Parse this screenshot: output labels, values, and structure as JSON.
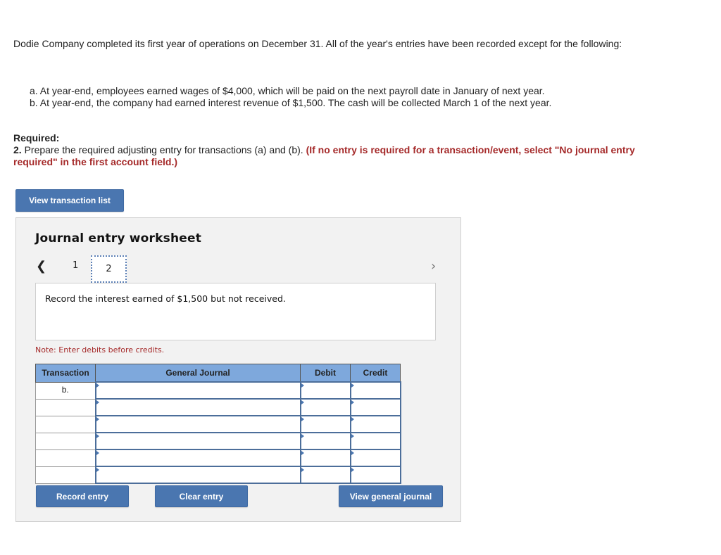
{
  "problem": {
    "intro": "Dodie Company completed its first year of operations on December 31. All of the year's entries have been recorded except for the following:",
    "items": [
      "a. At year-end, employees earned wages of $4,000, which will be paid on the next payroll date in January of next year.",
      "b. At year-end, the company had earned interest revenue of $1,500. The cash will be collected March 1 of the next year."
    ],
    "required_heading": "Required:",
    "required_number": "2.",
    "required_text": " Prepare the required adjusting entry for transactions (a) and (b). ",
    "required_instruction": "(If no entry is required for a transaction/event, select \"No journal entry required\" in the first account field.)"
  },
  "buttons": {
    "view_transaction_list": "View transaction list",
    "record_entry": "Record entry",
    "clear_entry": "Clear entry",
    "view_general_journal": "View general journal"
  },
  "worksheet": {
    "title": "Journal entry worksheet",
    "nav_prev_icon": "chevron-left-icon",
    "nav_next_icon": "chevron-right-icon",
    "tabs": [
      "1",
      "2"
    ],
    "active_tab": "2",
    "description": "Record the interest earned of $1,500 but not received.",
    "note": "Note: Enter debits before credits."
  },
  "journal_table": {
    "headers": [
      "Transaction",
      "General Journal",
      "Debit",
      "Credit"
    ],
    "rows": [
      {
        "transaction": "b.",
        "account": "",
        "debit": "",
        "credit": ""
      },
      {
        "transaction": "",
        "account": "",
        "debit": "",
        "credit": ""
      },
      {
        "transaction": "",
        "account": "",
        "debit": "",
        "credit": ""
      },
      {
        "transaction": "",
        "account": "",
        "debit": "",
        "credit": ""
      },
      {
        "transaction": "",
        "account": "",
        "debit": "",
        "credit": ""
      },
      {
        "transaction": "",
        "account": "",
        "debit": "",
        "credit": ""
      }
    ]
  },
  "colors": {
    "button_blue": "#4a76b0",
    "header_blue": "#7ea8dc",
    "instruction_red": "#a52a2a",
    "panel_bg": "#f2f2f2"
  }
}
